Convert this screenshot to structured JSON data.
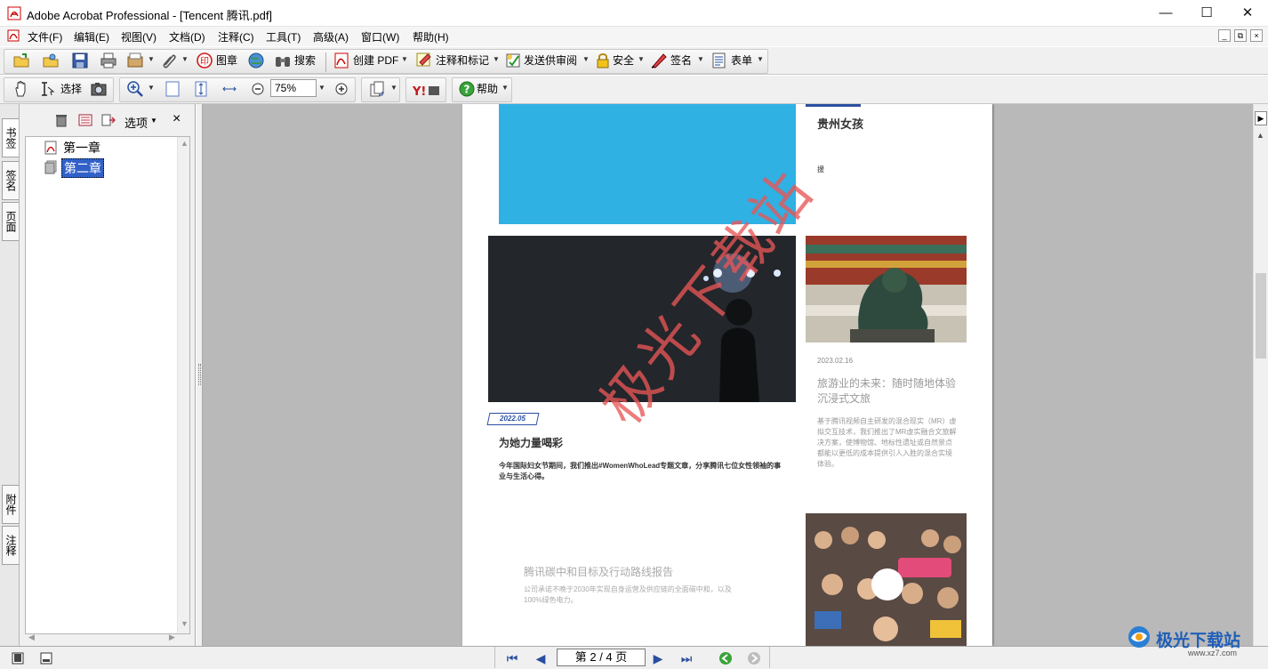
{
  "window": {
    "title": "Adobe Acrobat Professional - [Tencent 腾讯.pdf]",
    "controls": [
      "—",
      "☐",
      "✕"
    ]
  },
  "menu": {
    "items": [
      "文件(F)",
      "编辑(E)",
      "视图(V)",
      "文档(D)",
      "注释(C)",
      "工具(T)",
      "高级(A)",
      "窗口(W)",
      "帮助(H)"
    ],
    "mdi_controls": [
      "_",
      "⧉",
      "×"
    ]
  },
  "toolbar1": {
    "stamp_label": "图章",
    "search_label": "搜索",
    "create_pdf_label": "创建 PDF",
    "comment_label": "注释和标记",
    "review_label": "发送供审阅",
    "security_label": "安全",
    "sign_label": "签名",
    "forms_label": "表单"
  },
  "toolbar2": {
    "select_label": "选择",
    "zoom_value": "75%",
    "help_label": "帮助"
  },
  "nav_tabs": {
    "bookmarks": "书签",
    "signatures": "签名",
    "pages": "页面",
    "attachments": "附件",
    "comments": "注释"
  },
  "bookmarks_panel": {
    "options_label": "选项",
    "items": [
      {
        "label": "第一章",
        "selected": false
      },
      {
        "label": "第二章",
        "selected": true
      }
    ]
  },
  "document": {
    "right_col_title": "贵州女孩",
    "right_col_small": "援",
    "article1": {
      "date": "2022.05",
      "title": "为她力量喝彩",
      "body_line1": "今年国际妇女节期间，我们推出#WomenWhoLead专题文章，分享腾讯七位女性领袖的事",
      "body_line2": "业与生活心得。"
    },
    "article2": {
      "date": "2023.02.16",
      "title_line1": "旅游业的未来：随时随地体验",
      "title_line2": "沉浸式文旅",
      "body_lines": [
        "基于腾讯视频自主研发的混合现实（MR）虚",
        "拟交互技术，我们推出了MR虚实融合文旅解",
        "决方案，使博物馆、地标性遗址或自然景点",
        "都能以更低的成本提供引人入胜的混合实境",
        "体验。"
      ]
    },
    "article3": {
      "title": "腾讯碳中和目标及行动路线报告",
      "body_line1": "公司承诺不晚于2030年实现自身运营及供应链的全面碳中和，以及",
      "body_line2": "100%绿色电力。"
    },
    "watermark": "极光下载站",
    "colors": {
      "cyan_block": "#2fb1e4",
      "watermark": "#e85656",
      "date_badge": "#2a4fa0"
    }
  },
  "statusbar": {
    "page_indicator": "第 2 / 4 页",
    "brand_text": "极光下载站",
    "brand_url": "www.xz7.com"
  }
}
